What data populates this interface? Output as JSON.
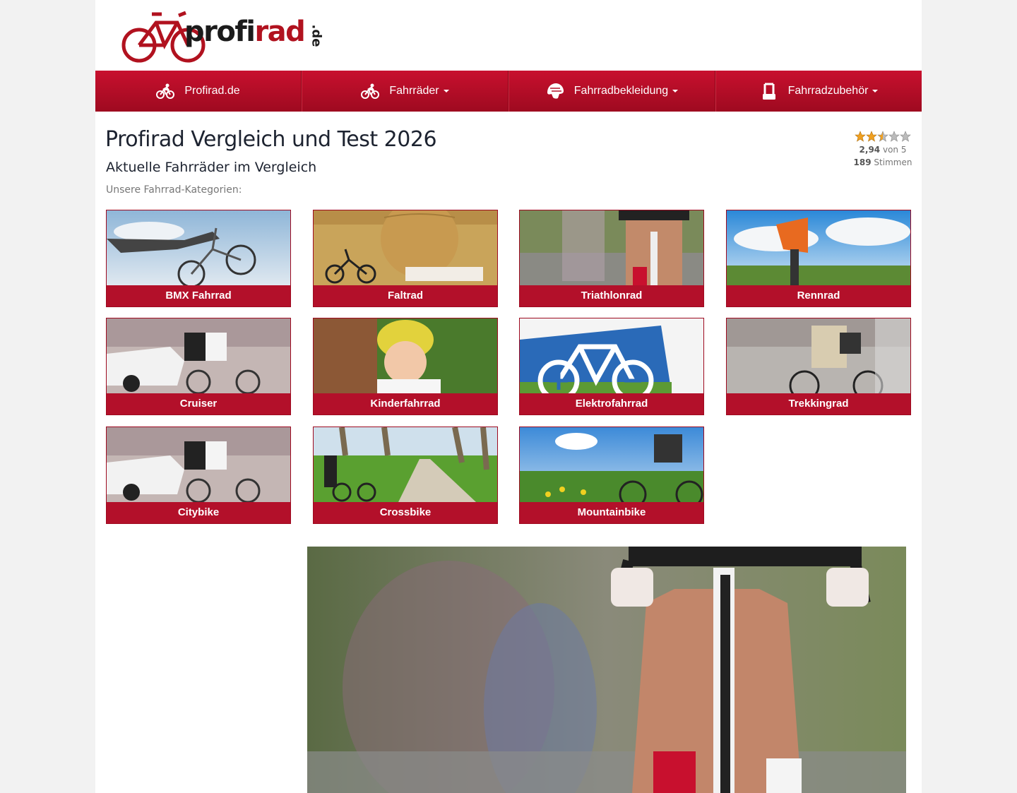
{
  "brand": {
    "name_part1": "profi",
    "name_part2": "rad",
    "tld": ".de"
  },
  "nav": [
    {
      "label": "Profirad.de",
      "icon": "cyclist-icon",
      "dropdown": false
    },
    {
      "label": "Fahrräder",
      "icon": "cyclist-icon",
      "dropdown": true
    },
    {
      "label": "Fahrradbekleidung",
      "icon": "helmet-icon",
      "dropdown": true
    },
    {
      "label": "Fahrradzubehör",
      "icon": "lock-icon",
      "dropdown": true
    }
  ],
  "page": {
    "title": "Profirad Vergleich und Test 2026",
    "subtitle": "Aktuelle Fahrräder im Vergleich",
    "categories_label": "Unsere Fahrrad-Kategorien:"
  },
  "rating": {
    "score": "2,94",
    "of_text": "von 5",
    "votes": "189",
    "votes_text": "Stimmen",
    "stars_filled": 2.5,
    "stars_total": 5
  },
  "categories": [
    {
      "label": "BMX Fahrrad"
    },
    {
      "label": "Faltrad"
    },
    {
      "label": "Triathlonrad"
    },
    {
      "label": "Rennrad"
    },
    {
      "label": "Cruiser"
    },
    {
      "label": "Kinderfahrrad"
    },
    {
      "label": "Elektrofahrrad"
    },
    {
      "label": "Trekkingrad"
    },
    {
      "label": "Citybike"
    },
    {
      "label": "Crossbike"
    },
    {
      "label": "Mountainbike"
    }
  ],
  "colors": {
    "accent": "#b3102a",
    "nav_top": "#c8102e",
    "nav_bottom": "#9e0a20",
    "star": "#f0a020"
  }
}
